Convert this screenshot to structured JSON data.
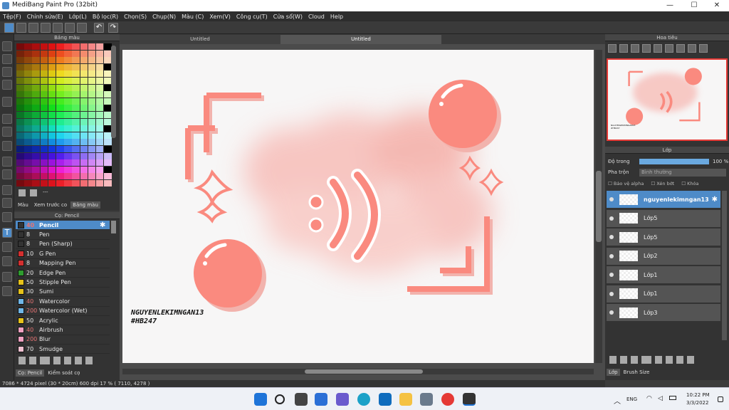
{
  "window": {
    "title": "MediBang Paint Pro (32bit)",
    "minimize": "—",
    "maximize": "☐",
    "close": "✕"
  },
  "menu": [
    "Tệp(F)",
    "Chỉnh sửa(E)",
    "Lớp(L)",
    "Bộ lọc(R)",
    "Chọn(S)",
    "Chụp(N)",
    "Màu (C)",
    "Xem(V)",
    "Công cụ(T)",
    "Cửa sổ(W)",
    "Cloud",
    "Help"
  ],
  "color_panel": {
    "title": "Bảng màu",
    "more": "---",
    "tabs": [
      "Màu",
      "Xem trước co",
      "Bảng màu"
    ]
  },
  "brush_panel": {
    "title": "Cọ: Pencil",
    "brushes": [
      {
        "size": "40",
        "name": "Pencil",
        "color": "#333333",
        "selected": true
      },
      {
        "size": "8",
        "name": "Pen",
        "color": "#333333"
      },
      {
        "size": "8",
        "name": "Pen (Sharp)",
        "color": "#333333"
      },
      {
        "size": "10",
        "name": "G Pen",
        "color": "#d32f2f"
      },
      {
        "size": "8",
        "name": "Mapping Pen",
        "color": "#d32f2f"
      },
      {
        "size": "20",
        "name": "Edge Pen",
        "color": "#2e9d2e"
      },
      {
        "size": "50",
        "name": "Stipple Pen",
        "color": "#e6c21a"
      },
      {
        "size": "30",
        "name": "Sumi",
        "color": "#e6c21a"
      },
      {
        "size": "40",
        "name": "Watercolor",
        "color": "#6fb6e8"
      },
      {
        "size": "200",
        "name": "Watercolor (Wet)",
        "color": "#6fb6e8"
      },
      {
        "size": "50",
        "name": "Acrylic",
        "color": "#e6c21a"
      },
      {
        "size": "40",
        "name": "Airbrush",
        "color": "#f0a0c0"
      },
      {
        "size": "200",
        "name": "Blur",
        "color": "#f0a0c0"
      },
      {
        "size": "70",
        "name": "Smudge",
        "color": "#f0c0d0"
      }
    ],
    "tabs": [
      "Cọ: Pencil",
      "Kiểm soát cọ"
    ]
  },
  "doc_tabs": [
    "Untitled",
    "Untitled"
  ],
  "canvas_text": {
    "line1": "NGUYENLEKIMNGAN13",
    "line2": "#HB247"
  },
  "navigator": {
    "title": "Hoa tiêu",
    "caption": "NGUYENLEKIMNGAN13\n#HB247"
  },
  "layer_panel": {
    "title": "Lớp",
    "opacity_label": "Độ trong",
    "opacity_value": "100 %",
    "opacity": 1.0,
    "blend_label": "Pha trộn",
    "blend_value": "Bình thường",
    "checks": [
      "Bảo vệ alpha",
      "Xén bớt",
      "Khóa"
    ],
    "layers": [
      {
        "name": "nguyenlekimngan13",
        "selected": true
      },
      {
        "name": "Lớp5"
      },
      {
        "name": "Lớp5"
      },
      {
        "name": "Lớp2"
      },
      {
        "name": "Lớp1"
      },
      {
        "name": "Lớp1"
      },
      {
        "name": "Lớp3"
      }
    ],
    "bottom_tabs": [
      "Lớp",
      "Brush Size"
    ]
  },
  "status": "7086 * 4724 pixel   (30 * 20cm)   600 dpi   17 %   ( 7110, 4278 )",
  "taskbar": {
    "lang": "ENG",
    "time": "10:22 PM",
    "date": "3/3/2022"
  },
  "colors": {
    "accent": "#4e8bc8",
    "coral": "#fa8a7f",
    "coral_shadow": "#f2b3ad"
  }
}
